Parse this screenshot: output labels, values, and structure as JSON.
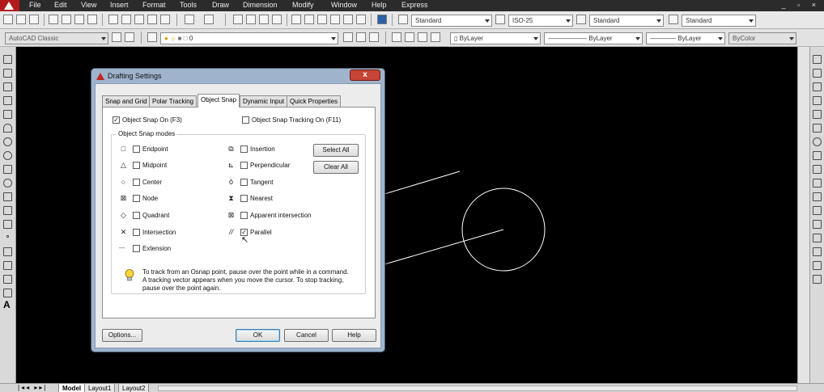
{
  "menu": {
    "items": [
      "File",
      "Edit",
      "View",
      "Insert",
      "Format",
      "Tools",
      "Draw",
      "Dimension",
      "Modify",
      "Window",
      "Help",
      "Express"
    ],
    "window_controls": "_ ▫ ×"
  },
  "toolbar1": {
    "text_style": "Standard",
    "dim_style": "ISO-25",
    "table_style": "Standard",
    "mleader_style": "Standard"
  },
  "toolbar2": {
    "workspace": "AutoCAD Classic",
    "layer": "0",
    "color": "ByLayer",
    "linetype": "ByLayer",
    "lineweight": "ByLayer",
    "plot_style": "ByColor"
  },
  "dialog": {
    "title": "Drafting Settings",
    "close": "x",
    "tabs": [
      "Snap and Grid",
      "Polar Tracking",
      "Object Snap",
      "Dynamic Input",
      "Quick Properties"
    ],
    "active_tab": "Object Snap",
    "osnap_on": {
      "label": "Object Snap On (F3)",
      "checked": true
    },
    "osnap_tracking": {
      "label": "Object Snap Tracking On (F11)",
      "checked": false
    },
    "modes_title": "Object Snap modes",
    "left_modes": [
      {
        "label": "Endpoint",
        "symbol": "□",
        "checked": false
      },
      {
        "label": "Midpoint",
        "symbol": "△",
        "checked": false
      },
      {
        "label": "Center",
        "symbol": "○",
        "checked": false
      },
      {
        "label": "Node",
        "symbol": "⊠",
        "checked": false
      },
      {
        "label": "Quadrant",
        "symbol": "◇",
        "checked": false
      },
      {
        "label": "Intersection",
        "symbol": "✕",
        "checked": false
      },
      {
        "label": "Extension",
        "symbol": "---",
        "checked": false
      }
    ],
    "right_modes": [
      {
        "label": "Insertion",
        "symbol": "⧉",
        "checked": false
      },
      {
        "label": "Perpendicular",
        "symbol": "⊾",
        "checked": false
      },
      {
        "label": "Tangent",
        "symbol": "ō",
        "checked": false
      },
      {
        "label": "Nearest",
        "symbol": "⧗",
        "checked": false
      },
      {
        "label": "Apparent intersection",
        "symbol": "⊠",
        "checked": false
      },
      {
        "label": "Parallel",
        "symbol": "//",
        "checked": true
      }
    ],
    "select_all": "Select All",
    "clear_all": "Clear All",
    "info": "To track from an Osnap point, pause over the point while in a command.  A tracking vector appears when you move the cursor. To stop tracking, pause over the point again.",
    "buttons": {
      "options": "Options...",
      "ok": "OK",
      "cancel": "Cancel",
      "help": "Help"
    }
  },
  "layout_tabs": [
    "Model",
    "Layout1",
    "Layout2"
  ],
  "colors": {
    "drawing_bg": "#000000",
    "dialog_frame": "#9fb4cc",
    "title_close": "#c64536"
  }
}
